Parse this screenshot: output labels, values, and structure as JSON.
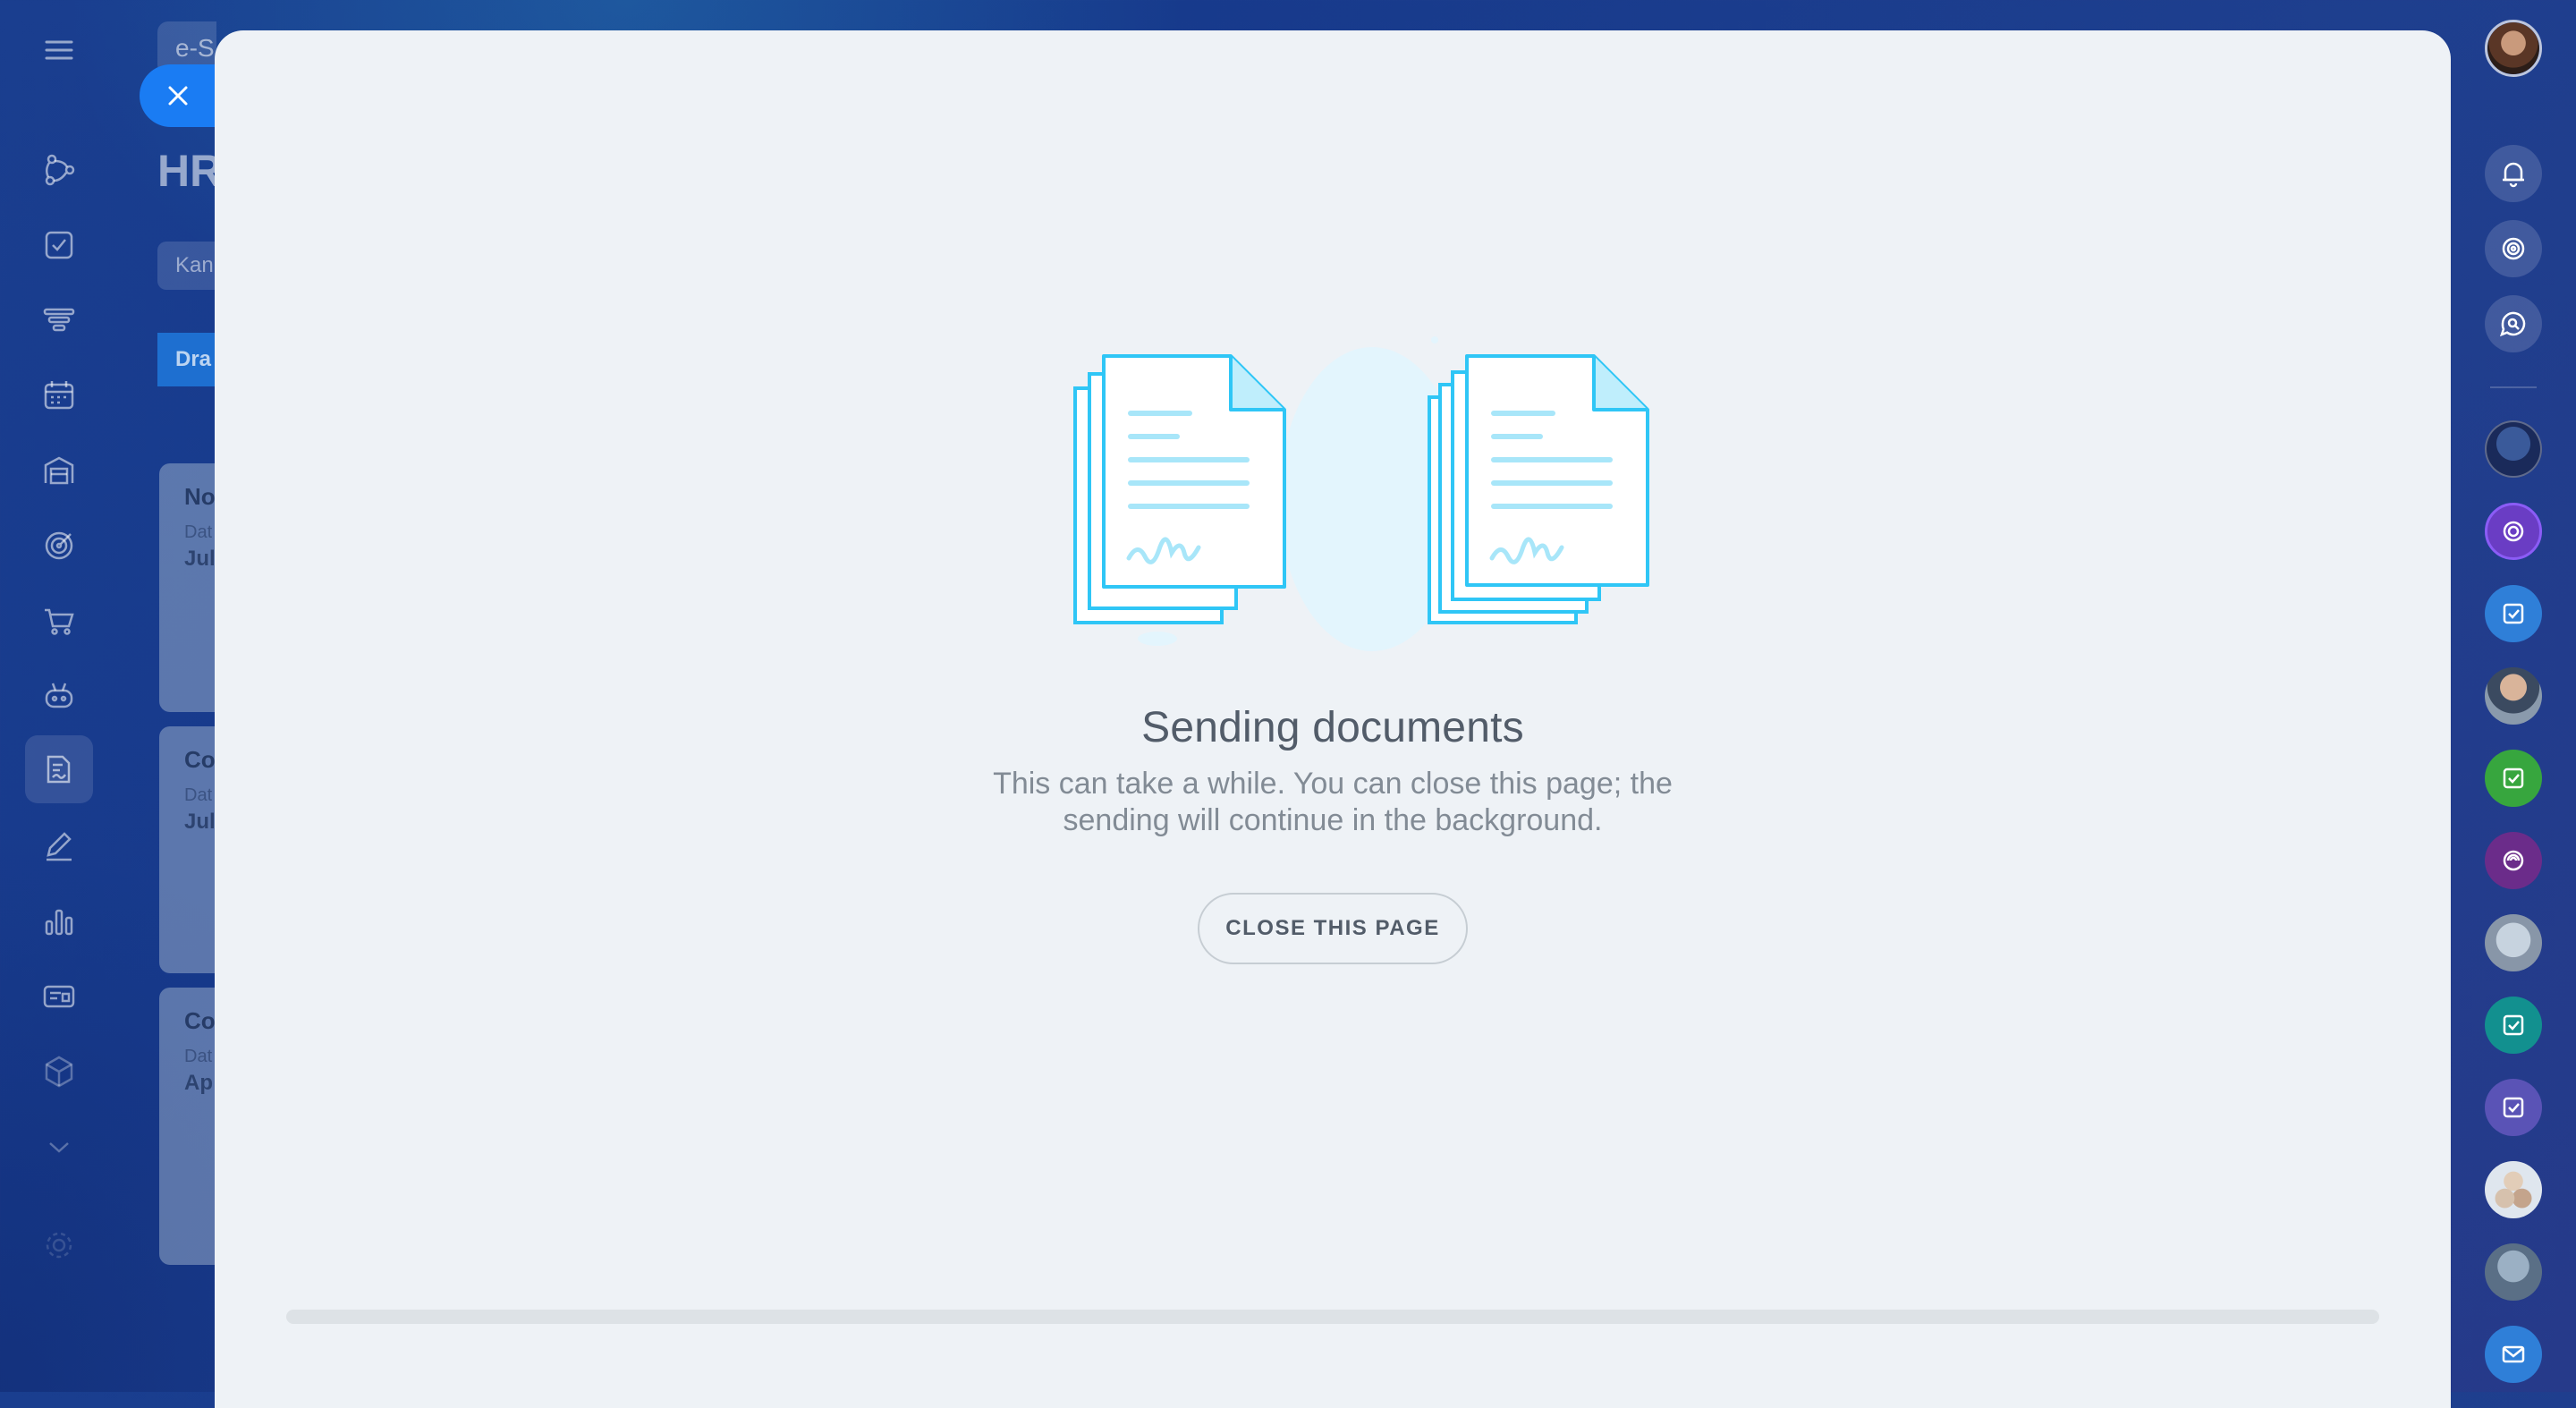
{
  "background": {
    "search_placeholder": "e-S",
    "page_title": "HR",
    "view_chip": "Kan",
    "column_header": "Dra",
    "cards": [
      {
        "title": "No (N",
        "sub": "Dat",
        "value": "Jul"
      },
      {
        "title": "Co",
        "sub": "Dat",
        "value": "Jul"
      },
      {
        "title": "Co",
        "sub": "Dat",
        "value": "Ap"
      }
    ]
  },
  "left_sidebar": {
    "items": [
      {
        "name": "menu-icon"
      },
      {
        "name": "crm-icon"
      },
      {
        "name": "tasks-icon"
      },
      {
        "name": "funnel-icon"
      },
      {
        "name": "calendar-icon"
      },
      {
        "name": "warehouse-icon"
      },
      {
        "name": "target-icon"
      },
      {
        "name": "cart-icon"
      },
      {
        "name": "robot-icon"
      },
      {
        "name": "sign-document-icon",
        "active": true
      },
      {
        "name": "pen-icon"
      },
      {
        "name": "analytics-icon"
      },
      {
        "name": "contact-card-icon"
      },
      {
        "name": "cube-icon"
      },
      {
        "name": "chevron-down-icon"
      },
      {
        "name": "gear-icon"
      }
    ]
  },
  "modal": {
    "title": "Sending documents",
    "text": "This can take a while. You can close this page; the sending will continue in the background.",
    "button_label": "CLOSE THIS PAGE",
    "progress": 0
  },
  "right_sidebar": {
    "items": [
      {
        "name": "user-avatar"
      },
      {
        "name": "bell-icon"
      },
      {
        "name": "copilot-icon"
      },
      {
        "name": "search-chat-icon"
      },
      {
        "name": "contact-avatar-1"
      },
      {
        "name": "copilot-chat-icon"
      },
      {
        "name": "task-chat-icon-1"
      },
      {
        "name": "contact-avatar-2"
      },
      {
        "name": "task-chat-icon-2"
      },
      {
        "name": "ai-chat-icon"
      },
      {
        "name": "bot-avatar"
      },
      {
        "name": "task-chat-icon-3"
      },
      {
        "name": "task-chat-icon-4"
      },
      {
        "name": "group-chat-avatar"
      },
      {
        "name": "contact-avatar-3"
      },
      {
        "name": "mail-icon"
      }
    ]
  },
  "colors": {
    "accent": "#1a7cf3",
    "doc_stroke": "#2fc6f6",
    "modal_bg": "#eef2f6",
    "title_text": "#525c69",
    "body_text": "#828b95"
  }
}
